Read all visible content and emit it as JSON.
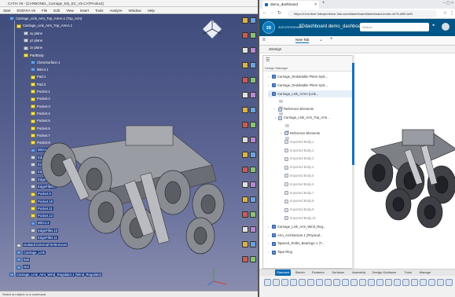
{
  "catia": {
    "title": "CATIA V5 - [CARBONEL_Carriage_EQ_EC_V5.CATProduct]",
    "menu": [
      "Start",
      "ENOVIA V5",
      "File",
      "Edit",
      "View",
      "Insert",
      "Tools",
      "Analyze",
      "Window",
      "Help"
    ],
    "tree": [
      {
        "label": "Carriage_Link_Arm_Top_ArmA.1 (Top_Arm)",
        "icon": "product-icon",
        "kind": "b",
        "indent": 0
      },
      {
        "label": "Carriage_Link_Arm_Top_ArmA.1",
        "icon": "part-icon",
        "kind": "y",
        "indent": 1
      },
      {
        "label": "xy plane",
        "icon": "plane-icon",
        "kind": "g",
        "indent": 2
      },
      {
        "label": "yz plane",
        "icon": "plane-icon",
        "kind": "g",
        "indent": 2
      },
      {
        "label": "zx plane",
        "icon": "plane-icon",
        "kind": "g",
        "indent": 2
      },
      {
        "label": "PartBody",
        "icon": "body-icon",
        "kind": "y",
        "indent": 2
      },
      {
        "label": "CloseSurface.1",
        "icon": "feature-icon",
        "kind": "b",
        "indent": 3
      },
      {
        "label": "Mirror.1",
        "icon": "feature-icon",
        "kind": "b",
        "indent": 3
      },
      {
        "label": "Pad.1",
        "icon": "feature-icon",
        "kind": "y",
        "indent": 3
      },
      {
        "label": "Pad.2",
        "icon": "feature-icon",
        "kind": "y",
        "indent": 3
      },
      {
        "label": "Pocket.1",
        "icon": "feature-icon",
        "kind": "y",
        "indent": 3
      },
      {
        "label": "Pocket.2",
        "icon": "feature-icon",
        "kind": "y",
        "indent": 3
      },
      {
        "label": "Pocket.3",
        "icon": "feature-icon",
        "kind": "y",
        "indent": 3
      },
      {
        "label": "Pocket.4",
        "icon": "feature-icon",
        "kind": "y",
        "indent": 3
      },
      {
        "label": "Pocket.5",
        "icon": "feature-icon",
        "kind": "y",
        "indent": 3
      },
      {
        "label": "Pocket.6",
        "icon": "feature-icon",
        "kind": "y",
        "indent": 3
      },
      {
        "label": "Pocket.7",
        "icon": "feature-icon",
        "kind": "y",
        "indent": 3
      },
      {
        "label": "Pocket.8",
        "icon": "feature-icon",
        "kind": "y",
        "indent": 3
      },
      {
        "label": "Mirror.2",
        "icon": "feature-icon",
        "kind": "b",
        "indent": 3,
        "sel": true
      },
      {
        "label": "EdgeFillet.1",
        "icon": "feature-icon",
        "kind": "g",
        "indent": 3,
        "sel": true
      },
      {
        "label": "EdgeFillet.3",
        "icon": "feature-icon",
        "kind": "g",
        "indent": 3,
        "sel": true
      },
      {
        "label": "EdgeFillet.4",
        "icon": "feature-icon",
        "kind": "g",
        "indent": 3,
        "sel": true
      },
      {
        "label": "EdgeFillet.5",
        "icon": "feature-icon",
        "kind": "g",
        "indent": 3,
        "sel": true
      },
      {
        "label": "EdgeFillet.8",
        "icon": "feature-icon",
        "kind": "g",
        "indent": 3,
        "sel": true
      },
      {
        "label": "Pocket.9",
        "icon": "feature-icon",
        "kind": "y",
        "indent": 3,
        "sel": true
      },
      {
        "label": "Pocket.10",
        "icon": "feature-icon",
        "kind": "y",
        "indent": 3,
        "sel": true
      },
      {
        "label": "Pocket.11",
        "icon": "feature-icon",
        "kind": "y",
        "indent": 3,
        "sel": true
      },
      {
        "label": "Pocket.12",
        "icon": "feature-icon",
        "kind": "y",
        "indent": 3,
        "sel": true
      },
      {
        "label": "Mirror.3",
        "icon": "feature-icon",
        "kind": "b",
        "indent": 3,
        "sel": true
      },
      {
        "label": "EdgeFillet.10",
        "icon": "feature-icon",
        "kind": "g",
        "indent": 3,
        "sel": true
      },
      {
        "label": "EdgeFillet.11",
        "icon": "feature-icon",
        "kind": "g",
        "indent": 3,
        "sel": true
      },
      {
        "label": "Isolated External References",
        "icon": "ref-icon",
        "kind": "g",
        "indent": 1,
        "sel": true
      },
      {
        "label": "Carriage_Link",
        "icon": "product-icon",
        "kind": "b",
        "indent": 1,
        "sel": true
      },
      {
        "label": "Bolt",
        "icon": "product-icon",
        "kind": "b",
        "indent": 1,
        "sel": true
      },
      {
        "label": "Nut",
        "icon": "product-icon",
        "kind": "b",
        "indent": 1,
        "sel": true
      },
      {
        "label": "Carriage_Link_Arm_Wind_Regulator.1 (Wind_Regulator)",
        "icon": "product-icon",
        "kind": "b",
        "indent": 0,
        "sel": true
      }
    ],
    "status": "Select an object or a command",
    "compass_label": "z"
  },
  "browser": {
    "tab_title": "demo_dashboard",
    "url": "https://r1xe-ifwe.3dexperience.3ds.com/#dashboard/dashboard-mode-dc79-af09-bef1",
    "brand_label": "3DEXPERIENCE",
    "brand_text": "3Ddashboard  demo_dashboard",
    "search_placeholder": "Search",
    "newtab_label": "New Tab",
    "app_name": "xDesign",
    "panel_label": "Design Manager",
    "tree": [
      {
        "label": "Carriage_Deduktable Pliers Syst...",
        "indent": 0,
        "chev": "›",
        "kind": "normal"
      },
      {
        "label": "Carriage_Deduktable Pliers Syst...",
        "indent": 0,
        "chev": "›",
        "kind": "normal"
      },
      {
        "label": "Carriage_Link_ArmA (Link...",
        "indent": 0,
        "chev": "⌄",
        "kind": "sel"
      },
      {
        "label": "Reference Elements",
        "indent": 1,
        "chev": "›",
        "kind": "normal"
      },
      {
        "label": "Carriage_Link_Arm_Top_Arm...",
        "indent": 1,
        "chev": "⌄",
        "kind": "normal"
      },
      {
        "label": "Reference Elements",
        "indent": 2,
        "chev": "›",
        "kind": "normal"
      },
      {
        "label": "Imported Body.1",
        "indent": 2,
        "chev": "",
        "kind": "dim"
      },
      {
        "label": "Imported Body.2",
        "indent": 2,
        "chev": "",
        "kind": "dim"
      },
      {
        "label": "Imported Body.3",
        "indent": 2,
        "chev": "",
        "kind": "dim"
      },
      {
        "label": "Imported Body.4",
        "indent": 2,
        "chev": "",
        "kind": "dim"
      },
      {
        "label": "Imported Body.5",
        "indent": 2,
        "chev": "",
        "kind": "dim"
      },
      {
        "label": "Imported Body.6",
        "indent": 2,
        "chev": "",
        "kind": "dim"
      },
      {
        "label": "Imported Body.7",
        "indent": 2,
        "chev": "",
        "kind": "dim"
      },
      {
        "label": "Imported Body.8",
        "indent": 2,
        "chev": "",
        "kind": "dim"
      },
      {
        "label": "Imported Body.9",
        "indent": 2,
        "chev": "",
        "kind": "dim"
      },
      {
        "label": "Imported Body.10",
        "indent": 2,
        "chev": "",
        "kind": "dim"
      },
      {
        "label": "Carriage_Link_Arm_Wind_Reg...",
        "indent": 0,
        "chev": "›",
        "kind": "normal"
      },
      {
        "label": "Arm_Architecture.1 (Physical...",
        "indent": 0,
        "chev": "›",
        "kind": "normal"
      },
      {
        "label": "Tapered_Roller_BearingA.1 (T...",
        "indent": 0,
        "chev": "›",
        "kind": "normal"
      },
      {
        "label": "Tape Ring",
        "indent": 0,
        "chev": "›",
        "kind": "normal"
      }
    ],
    "bottom_tabs": [
      "Standard",
      "Sketch",
      "Features",
      "Surfaces",
      "Assembly",
      "Design Guidance",
      "Tools",
      "Manage"
    ],
    "active_bottom_tab": "Standard"
  },
  "colors": {
    "catia_bg_top": "#3c4a7a",
    "ds_blue": "#005686",
    "accent": "#0a6ab6"
  }
}
